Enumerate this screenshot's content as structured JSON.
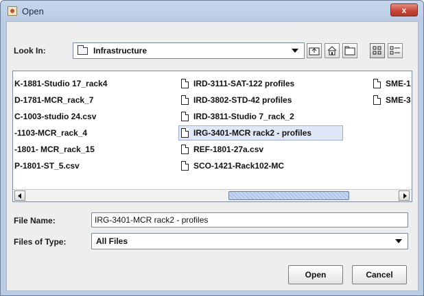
{
  "window": {
    "title": "Open",
    "close_glyph": "x"
  },
  "toolbar": {
    "look_in_label": "Look In:",
    "look_in_value": "Infrastructure"
  },
  "files": {
    "col1": [
      "K-1881-Studio 17_rack4",
      "D-1781-MCR_rack_7",
      "C-1003-studio 24.csv",
      "-1103-MCR_rack_4",
      "-1801- MCR_rack_15",
      "P-1801-ST_5.csv"
    ],
    "col2": [
      "IRD-3111-SAT-122 profiles",
      "IRD-3802-STD-42 profiles",
      "IRD-3811-Studio 7_rack_2",
      "IRG-3401-MCR rack2 - profiles",
      "REF-1801-27a.csv",
      "SCO-1421-Rack102-MC"
    ],
    "col3": [
      "SME-1",
      "SME-3"
    ],
    "selected": "IRG-3401-MCR rack2 - profiles"
  },
  "form": {
    "file_name_label": "File Name:",
    "file_name_value": "IRG-3401-MCR rack2 - profiles",
    "file_type_label": "Files of Type:",
    "file_type_value": "All Files"
  },
  "buttons": {
    "open": "Open",
    "cancel": "Cancel"
  },
  "colors": {
    "selection": "#dfe8f6",
    "close": "#c9473a",
    "frame": "#b9cce4"
  }
}
